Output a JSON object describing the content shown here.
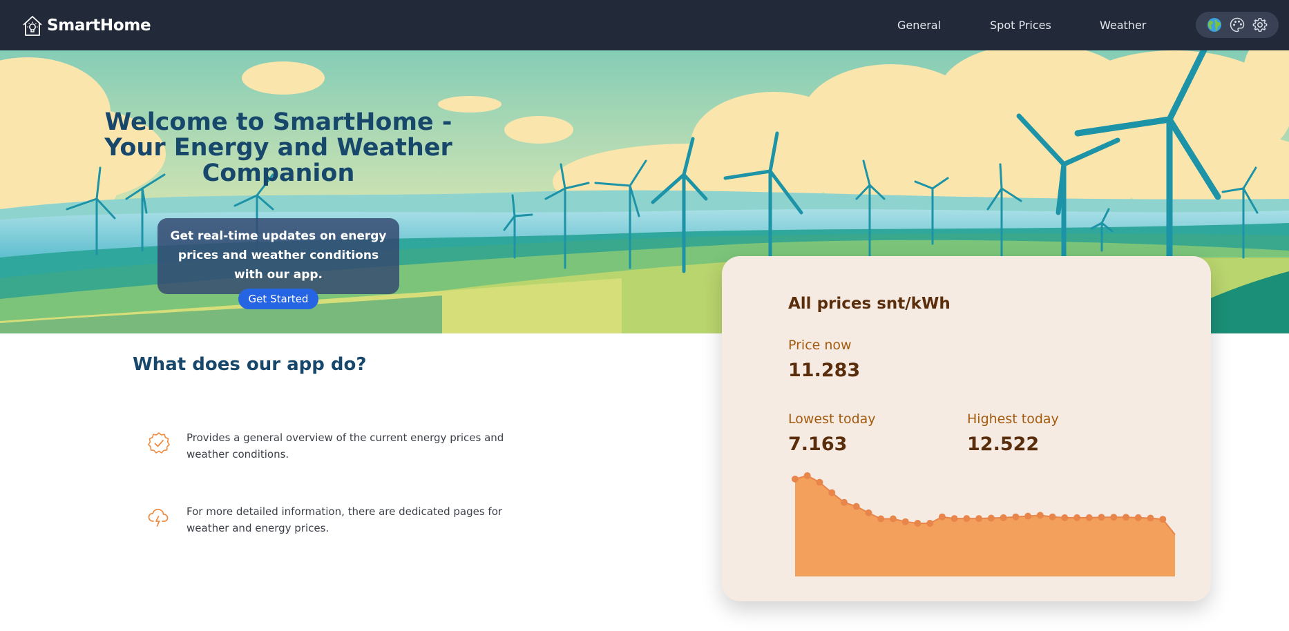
{
  "brand": {
    "name": "SmartHome",
    "icon": "smart-home-bulb-icon"
  },
  "nav": {
    "links": [
      "General",
      "Spot Prices",
      "Weather"
    ],
    "tools": [
      "globe-icon",
      "palette-icon",
      "gear-icon"
    ]
  },
  "hero": {
    "title": "Welcome to SmartHome - Your Energy and Weather Companion",
    "subtitle": "Get real-time updates on energy prices and weather conditions with our app.",
    "cta_label": "Get Started"
  },
  "features": {
    "heading": "What does our app do?",
    "items": [
      {
        "icon": "check-badge-icon",
        "text": "Provides a general overview of the current energy prices and weather conditions."
      },
      {
        "icon": "storm-cloud-icon",
        "text": "For more detailed information, there are dedicated pages for weather and energy prices."
      }
    ]
  },
  "prices": {
    "title": "All prices snt/kWh",
    "now_label": "Price now",
    "now_value": "11.283",
    "low_label": "Lowest today",
    "low_value": "7.163",
    "high_label": "Highest today",
    "high_value": "12.522"
  },
  "colors": {
    "navbar": "#222a3a",
    "accent_blue": "#2564e3",
    "heading_blue": "#17476b",
    "card_bg": "#f6ebe2",
    "chart_fill": "#f3a05d",
    "chart_point": "#e8854a",
    "feature_icon": "#f08a3e"
  },
  "chart_data": {
    "type": "area",
    "title": "",
    "xlabel": "",
    "ylabel": "",
    "ylim": [
      0,
      12.522
    ],
    "series": [
      {
        "values": [
          12.1,
          12.522,
          11.7,
          10.4,
          9.2,
          8.7,
          7.9,
          7.163,
          7.163,
          6.8,
          6.6,
          6.6,
          7.4,
          7.2,
          7.2,
          7.2,
          7.25,
          7.3,
          7.4,
          7.5,
          7.6,
          7.4,
          7.3,
          7.3,
          7.3,
          7.35,
          7.35,
          7.35,
          7.3,
          7.25,
          7.1,
          5.2
        ]
      }
    ]
  }
}
